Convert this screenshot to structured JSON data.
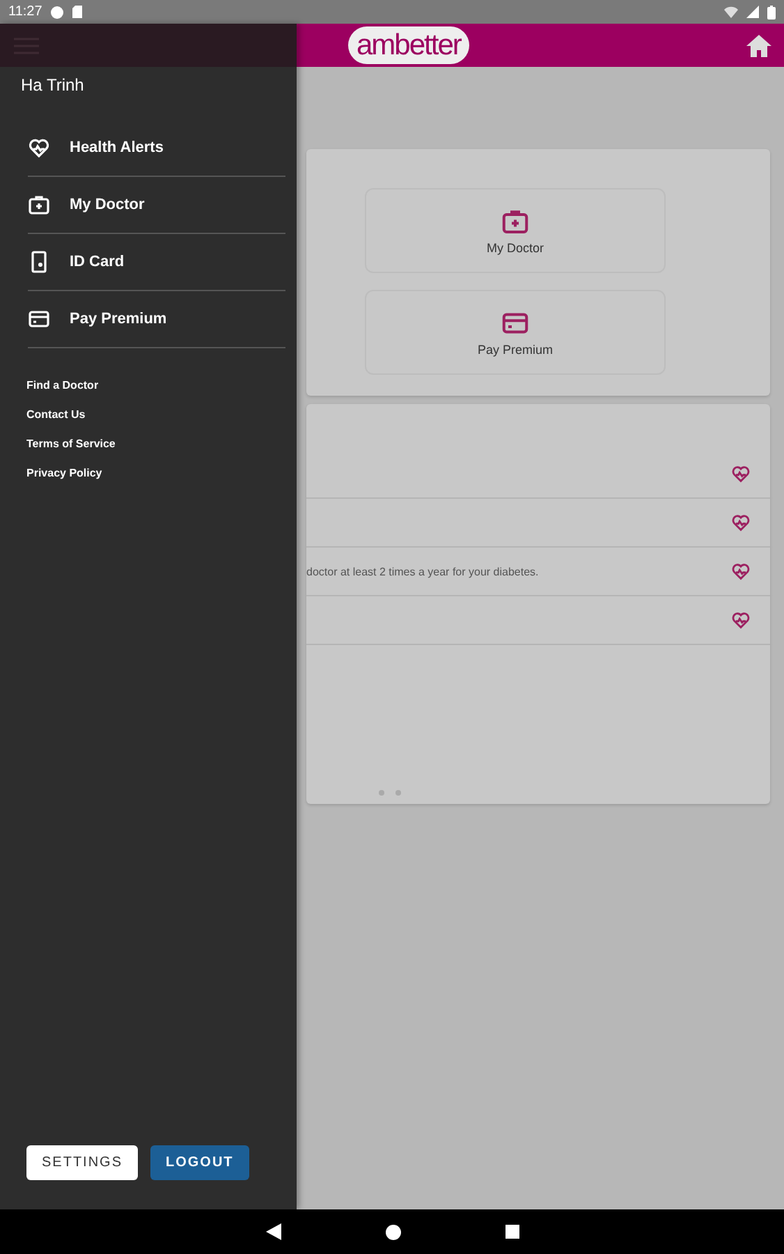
{
  "status_bar": {
    "time": "11:27"
  },
  "app_bar": {
    "logo": "ambetter"
  },
  "tiles": [
    {
      "label": "My Doctor",
      "kind": "bag"
    },
    {
      "label": "Pay Premium",
      "kind": "card"
    }
  ],
  "alerts": [
    {
      "kind": "alert"
    },
    {
      "kind": "alert"
    },
    {
      "kind": "alert",
      "text": "doctor at least 2 times a year for your diabetes."
    },
    {
      "kind": "alert"
    }
  ],
  "drawer": {
    "user_name": "Ha Trinh",
    "items": [
      {
        "label": "Health Alerts",
        "kind": "heart"
      },
      {
        "label": "My Doctor",
        "kind": "bag"
      },
      {
        "label": "ID Card",
        "kind": "id"
      },
      {
        "label": "Pay Premium",
        "kind": "card"
      }
    ],
    "links": [
      "Find a Doctor",
      "Contact Us",
      "Terms of Service",
      "Privacy Policy"
    ],
    "buttons": [
      {
        "label": "SETTINGS",
        "kind": "outline"
      },
      {
        "label": "LOGOUT",
        "kind": "primary"
      }
    ]
  }
}
